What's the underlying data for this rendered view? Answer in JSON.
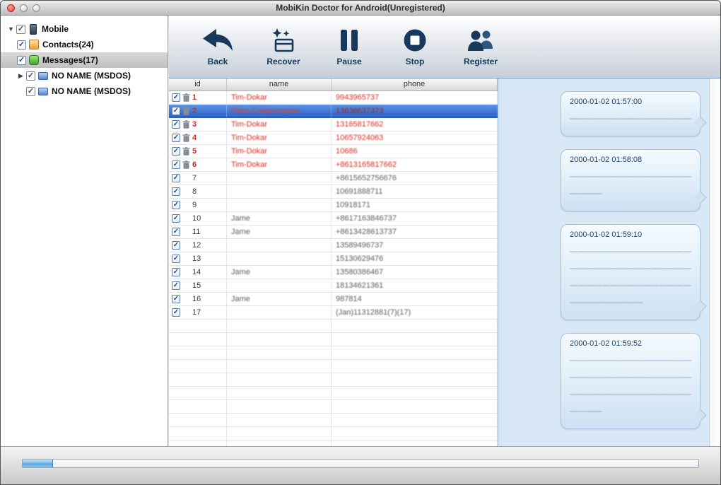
{
  "window": {
    "title": "MobiKin Doctor for Android(Unregistered)"
  },
  "sidebar": {
    "items": [
      {
        "label": "Mobile",
        "icon": "phone",
        "level": 0,
        "disclosure": "open",
        "checked": true,
        "selected": false
      },
      {
        "label": "Contacts(24)",
        "icon": "contacts",
        "level": 1,
        "disclosure": "none",
        "checked": true,
        "selected": false
      },
      {
        "label": "Messages(17)",
        "icon": "messages",
        "level": 1,
        "disclosure": "none",
        "checked": true,
        "selected": true
      },
      {
        "label": "NO NAME (MSDOS)",
        "icon": "disk",
        "level": 1,
        "disclosure": "closed",
        "checked": true,
        "selected": false
      },
      {
        "label": "NO NAME (MSDOS)",
        "icon": "disk",
        "level": 1,
        "disclosure": "blank",
        "checked": true,
        "selected": false
      }
    ]
  },
  "toolbar": {
    "buttons": [
      {
        "label": "Back"
      },
      {
        "label": "Recover"
      },
      {
        "label": "Pause"
      },
      {
        "label": "Stop"
      },
      {
        "label": "Register"
      }
    ]
  },
  "table": {
    "columns": [
      "id",
      "name",
      "phone"
    ],
    "rows": [
      {
        "id": "1",
        "name": "Tim-Dokar",
        "phone": "9943965737",
        "deleted": true,
        "selected": false,
        "checked": true
      },
      {
        "id": "2",
        "name": "Okea Cakanmawen",
        "phone": "13638637373",
        "deleted": true,
        "selected": true,
        "checked": true
      },
      {
        "id": "3",
        "name": "Tim-Dokar",
        "phone": "13165817662",
        "deleted": true,
        "selected": false,
        "checked": true
      },
      {
        "id": "4",
        "name": "Tim-Dokar",
        "phone": "10657924063",
        "deleted": true,
        "selected": false,
        "checked": true
      },
      {
        "id": "5",
        "name": "Tim-Dokar",
        "phone": "10686",
        "deleted": true,
        "selected": false,
        "checked": true
      },
      {
        "id": "6",
        "name": "Tim-Dokar",
        "phone": "+8613165817662",
        "deleted": true,
        "selected": false,
        "checked": true
      },
      {
        "id": "7",
        "name": "",
        "phone": "+8615652756676",
        "deleted": false,
        "selected": false,
        "checked": true
      },
      {
        "id": "8",
        "name": "",
        "phone": "10691888711",
        "deleted": false,
        "selected": false,
        "checked": true
      },
      {
        "id": "9",
        "name": "",
        "phone": "10918171",
        "deleted": false,
        "selected": false,
        "checked": true
      },
      {
        "id": "10",
        "name": "Jame",
        "phone": "+8617163846737",
        "deleted": false,
        "selected": false,
        "checked": true
      },
      {
        "id": "11",
        "name": "Jame",
        "phone": "+8613428613737",
        "deleted": false,
        "selected": false,
        "checked": true
      },
      {
        "id": "12",
        "name": "",
        "phone": "13589496737",
        "deleted": false,
        "selected": false,
        "checked": true
      },
      {
        "id": "13",
        "name": "",
        "phone": "15130629476",
        "deleted": false,
        "selected": false,
        "checked": true
      },
      {
        "id": "14",
        "name": "Jame",
        "phone": "13580386467",
        "deleted": false,
        "selected": false,
        "checked": true
      },
      {
        "id": "15",
        "name": "",
        "phone": "18134621361",
        "deleted": false,
        "selected": false,
        "checked": true
      },
      {
        "id": "16",
        "name": "Jame",
        "phone": "987814",
        "deleted": false,
        "selected": false,
        "checked": true
      },
      {
        "id": "17",
        "name": "",
        "phone": "(Jan)11312881(7)(17)",
        "deleted": false,
        "selected": false,
        "checked": true
      }
    ]
  },
  "messages": [
    {
      "time": "2000-01-02 01:57:00",
      "lines": [
        "———————————————"
      ]
    },
    {
      "time": "2000-01-02 01:58:08",
      "lines": [
        "———————————————",
        "————"
      ]
    },
    {
      "time": "2000-01-02 01:59:10",
      "lines": [
        "———————————————",
        "———————————————",
        "———————————————",
        "—————————"
      ]
    },
    {
      "time": "2000-01-02 01:59:52",
      "lines": [
        "———————————————",
        "———————————————",
        "———————————————",
        "————"
      ]
    }
  ],
  "progress": {
    "percent": 4.5
  },
  "colors": {
    "accent": "#17395c",
    "selected_row": "#2b5fc4",
    "deleted_red": "#d42a20",
    "panel_blue": "#d9e8f6"
  }
}
